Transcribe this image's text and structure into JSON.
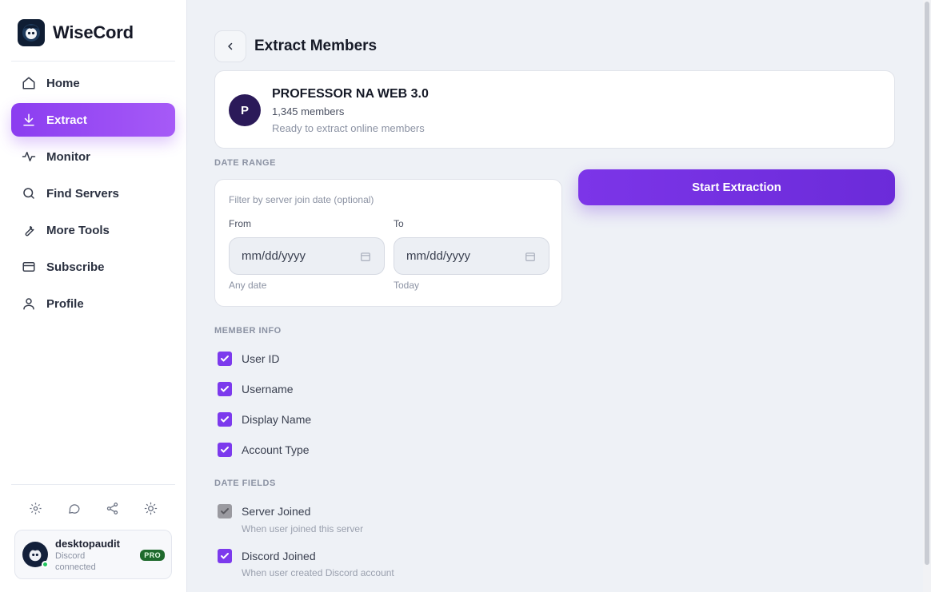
{
  "app": {
    "name": "WiseCord"
  },
  "sidebar": {
    "items": [
      {
        "label": "Home",
        "icon": "home-icon",
        "active": false
      },
      {
        "label": "Extract",
        "icon": "download-icon",
        "active": true
      },
      {
        "label": "Monitor",
        "icon": "activity-icon",
        "active": false
      },
      {
        "label": "Find Servers",
        "icon": "search-icon",
        "active": false
      },
      {
        "label": "More Tools",
        "icon": "wrench-icon",
        "active": false
      },
      {
        "label": "Subscribe",
        "icon": "credit-card-icon",
        "active": false
      },
      {
        "label": "Profile",
        "icon": "user-icon",
        "active": false
      }
    ],
    "footer_icons": [
      "gear-icon",
      "chat-bubble-icon",
      "share-icon",
      "sun-icon"
    ]
  },
  "user": {
    "name": "desktopaudit",
    "status": "Discord connected",
    "badge": "PRO"
  },
  "page": {
    "title": "Extract Members"
  },
  "server": {
    "initial": "P",
    "name": "PROFESSOR NA WEB 3.0",
    "members": "1,345 members",
    "status": "Ready to extract online members"
  },
  "date_range": {
    "section_label": "DATE RANGE",
    "hint": "Filter by server join date (optional)",
    "from_label": "From",
    "to_label": "To",
    "from_placeholder": "mm/dd/yyyy",
    "to_placeholder": "mm/dd/yyyy",
    "from_sub": "Any date",
    "to_sub": "Today"
  },
  "start_button": "Start Extraction",
  "member_info": {
    "section_label": "MEMBER INFO",
    "options": [
      {
        "label": "User ID",
        "checked": true
      },
      {
        "label": "Username",
        "checked": true
      },
      {
        "label": "Display Name",
        "checked": true
      },
      {
        "label": "Account Type",
        "checked": true
      }
    ]
  },
  "date_fields": {
    "section_label": "DATE FIELDS",
    "options": [
      {
        "label": "Server Joined",
        "desc": "When user joined this server",
        "checked": true,
        "disabled": true
      },
      {
        "label": "Discord Joined",
        "desc": "When user created Discord account",
        "checked": true,
        "disabled": false
      }
    ]
  },
  "colors": {
    "accent": "#7c3aed",
    "nav_active": "#9b4bf4",
    "pro_badge": "#1f6a2d"
  }
}
